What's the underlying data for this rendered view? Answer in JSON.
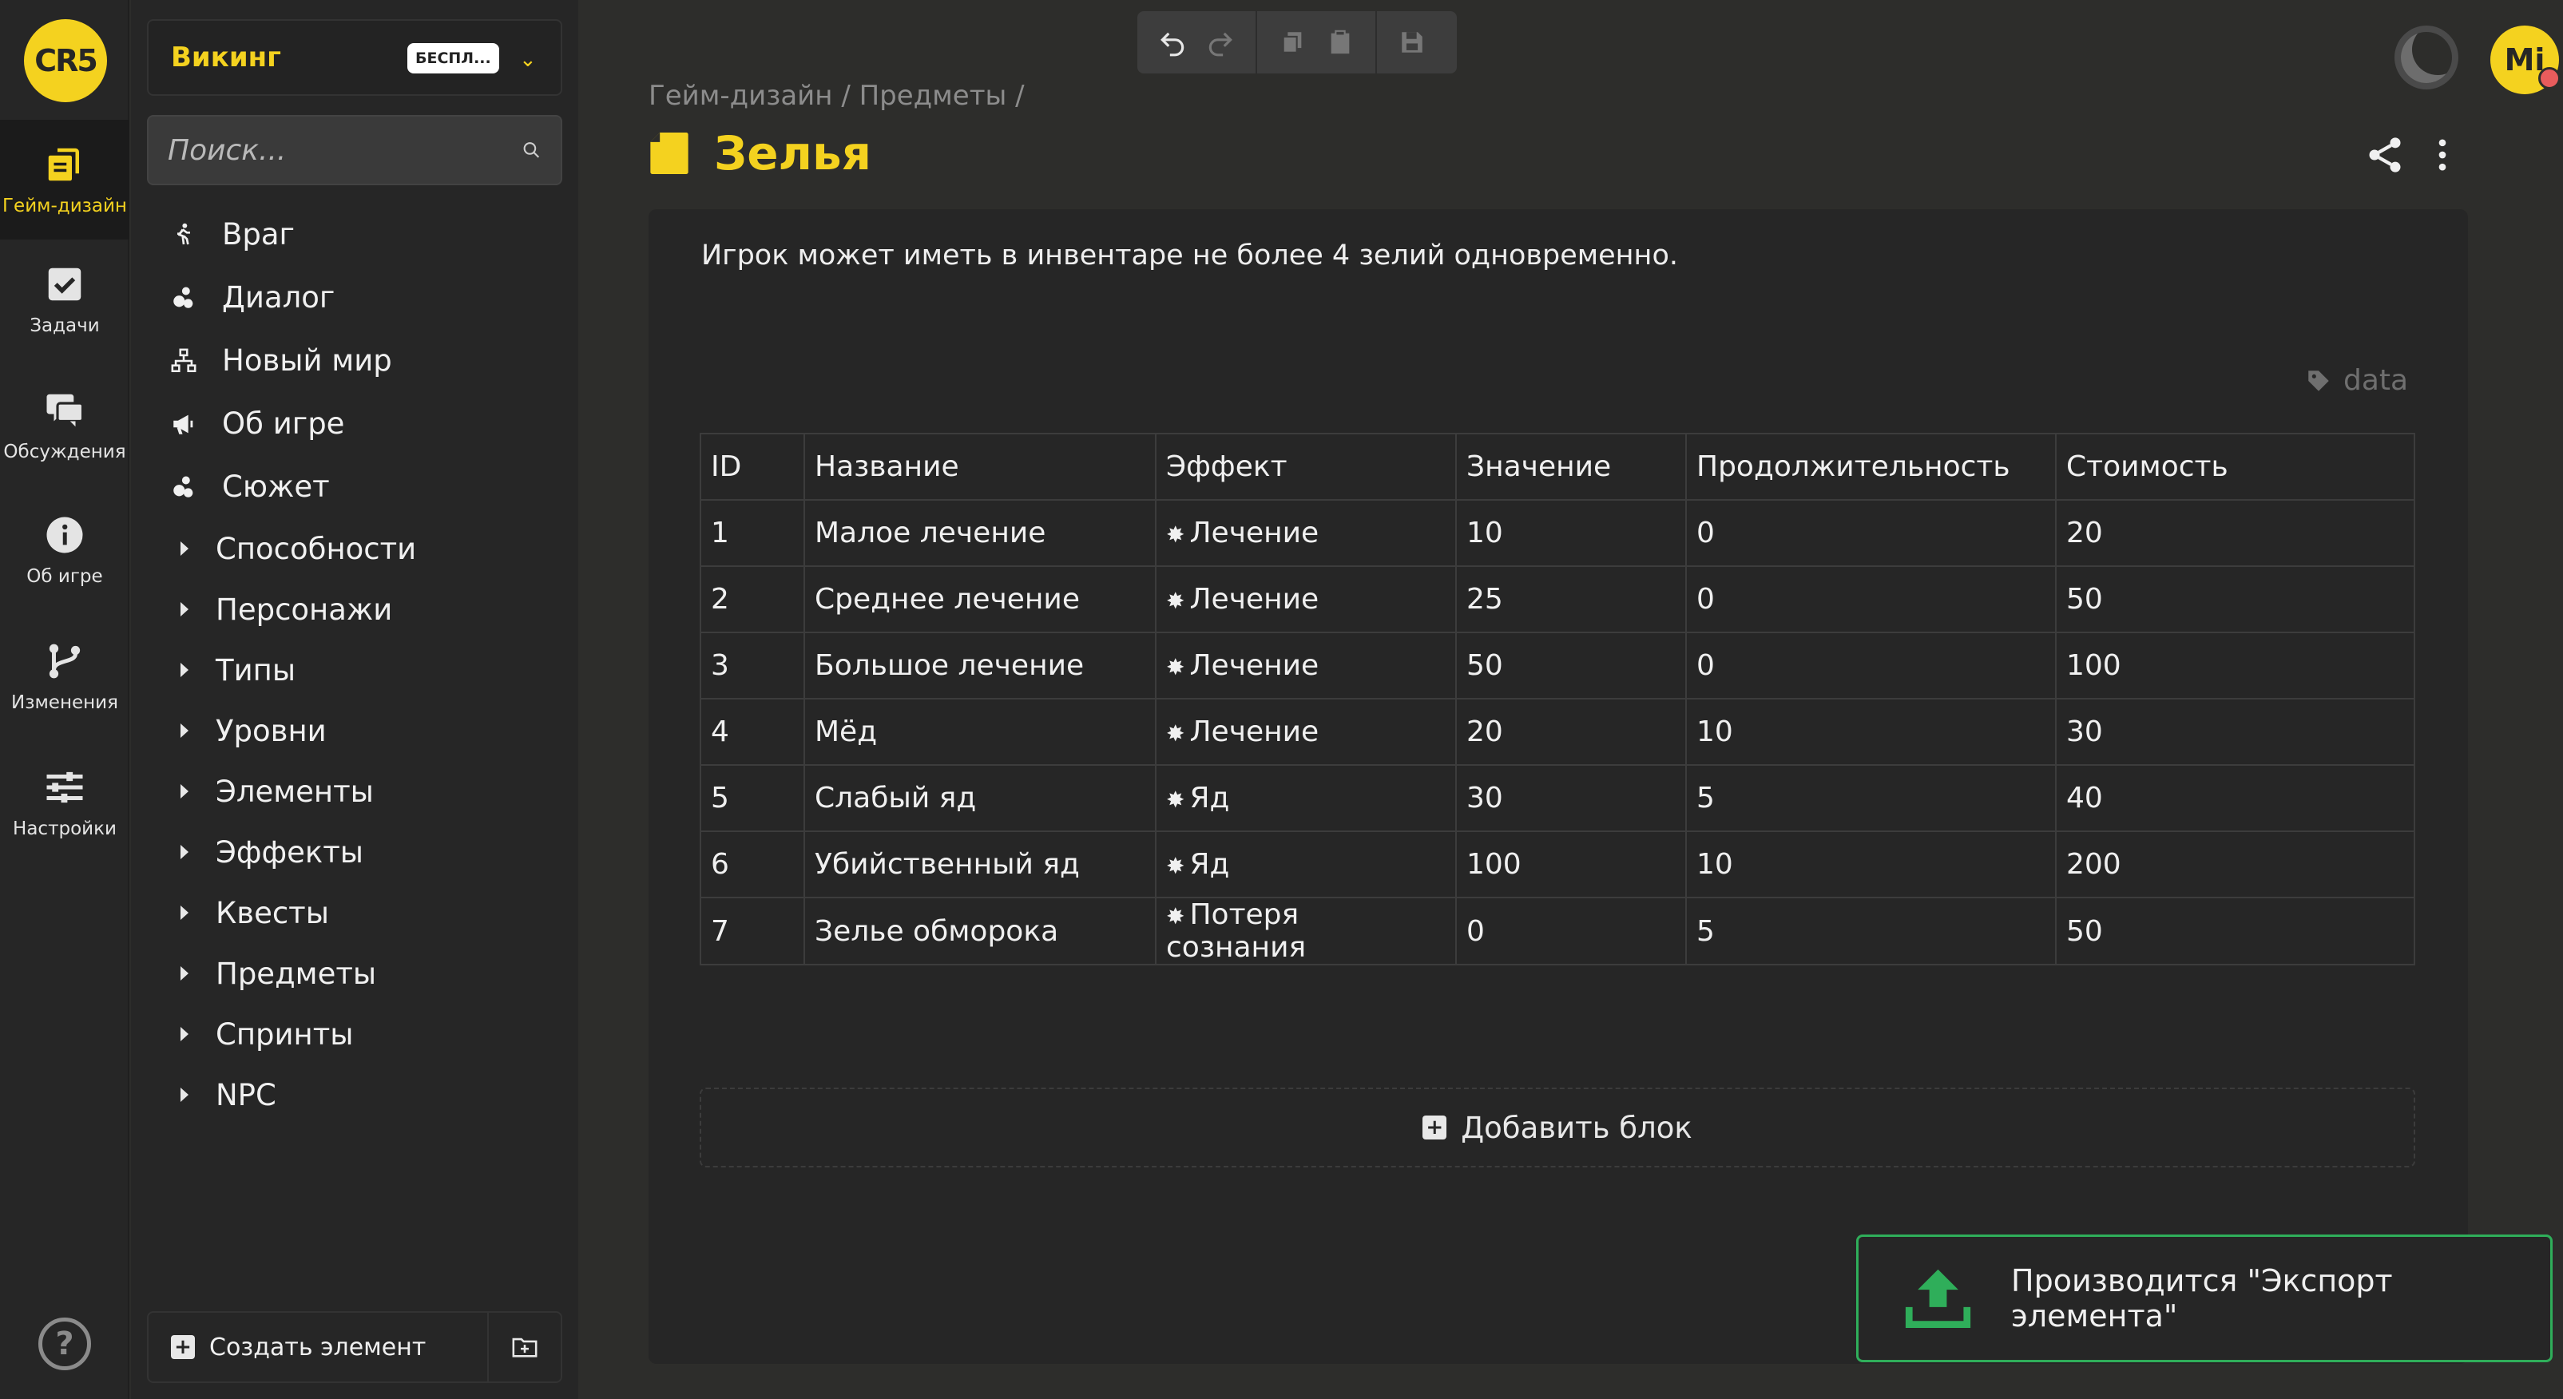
{
  "rail": {
    "logo_text": "CR5",
    "items": [
      {
        "label": "Гейм-дизайн",
        "icon": "game-design-icon"
      },
      {
        "label": "Задачи",
        "icon": "tasks-icon"
      },
      {
        "label": "Обсуждения",
        "icon": "discussions-icon"
      },
      {
        "label": "Об игре",
        "icon": "info-icon"
      },
      {
        "label": "Изменения",
        "icon": "branch-icon"
      },
      {
        "label": "Настройки",
        "icon": "settings-icon"
      }
    ],
    "help": "?"
  },
  "sidebar": {
    "project_name": "Викинг",
    "plan_badge": "БЕСПЛ...",
    "search_placeholder": "Поиск...",
    "items": [
      {
        "label": "Враг",
        "icon": "walker-icon"
      },
      {
        "label": "Диалог",
        "icon": "bubbles-icon"
      },
      {
        "label": "Новый мир",
        "icon": "sitemap-icon"
      },
      {
        "label": "Об игре",
        "icon": "megaphone-icon"
      },
      {
        "label": "Сюжет",
        "icon": "bubbles-icon"
      }
    ],
    "folders": [
      "Способности",
      "Персонажи",
      "Типы",
      "Уровни",
      "Элементы",
      "Эффекты",
      "Квесты",
      "Предметы",
      "Спринты",
      "NPC"
    ],
    "create_label": "Создать элемент"
  },
  "header": {
    "breadcrumb": "Гейм-дизайн / Предметы /",
    "title": "Зелья"
  },
  "content": {
    "description": "Игрок может иметь в инвентаре не более 4 зелий одновременно.",
    "tag": "data",
    "table": {
      "columns": [
        "ID",
        "Название",
        "Эффект",
        "Значение",
        "Продолжительность",
        "Стоимость"
      ],
      "rows": [
        [
          "1",
          "Малое лечение",
          "Лечение",
          "10",
          "0",
          "20"
        ],
        [
          "2",
          "Среднее лечение",
          "Лечение",
          "25",
          "0",
          "50"
        ],
        [
          "3",
          "Большое лечение",
          "Лечение",
          "50",
          "0",
          "100"
        ],
        [
          "4",
          "Мёд",
          "Лечение",
          "20",
          "10",
          "30"
        ],
        [
          "5",
          "Слабый яд",
          "Яд",
          "30",
          "5",
          "40"
        ],
        [
          "6",
          "Убийственный яд",
          "Яд",
          "100",
          "10",
          "200"
        ],
        [
          "7",
          "Зелье обморока",
          "Потеря сознания",
          "0",
          "5",
          "50"
        ]
      ]
    },
    "add_block": "Добавить блок"
  },
  "user": {
    "initials": "Mi"
  },
  "toast": {
    "message": "Производится \"Экспорт элемента\""
  },
  "colors": {
    "accent": "#f4d21f",
    "success": "#2fae5a",
    "background": "#2d2d2b",
    "panel": "#262626"
  }
}
